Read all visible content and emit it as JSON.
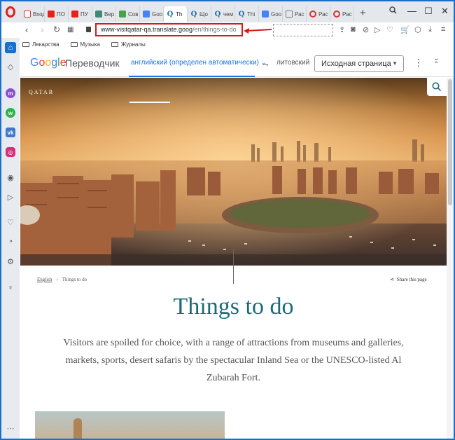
{
  "browser": {
    "tabs": [
      {
        "label": "Вход",
        "icon": "gmail-icon"
      },
      {
        "label": "ПО",
        "icon": "youtube-icon"
      },
      {
        "label": "ПУ",
        "icon": "youtube-icon"
      },
      {
        "label": "Вер",
        "icon": "tile-icon"
      },
      {
        "label": "Сов",
        "icon": "green-tile-icon"
      },
      {
        "label": "Goo",
        "icon": "google-icon"
      },
      {
        "label": "Th",
        "icon": "qatar-q-icon"
      },
      {
        "label": "Що",
        "icon": "qatar-q-icon"
      },
      {
        "label": "чем",
        "icon": "qatar-q-icon"
      },
      {
        "label": "Thi",
        "icon": "qatar-q-icon"
      },
      {
        "label": "Goo",
        "icon": "google-translate-icon"
      },
      {
        "label": "Рас",
        "icon": "cube-icon"
      },
      {
        "label": "Рас",
        "icon": "opera-icon"
      },
      {
        "label": "Рас",
        "icon": "opera-icon"
      }
    ],
    "url_host": "www-visitqatar-qa.translate.goog",
    "url_path": "/en/things-to-do",
    "bookmarks": [
      "Лекарства",
      "Музыка",
      "Журналы"
    ]
  },
  "translator": {
    "brand": "Google",
    "product": "Переводчик",
    "source_lang": "английский (определен автоматически)",
    "target_lang": "литовский",
    "view_mode": "Исходная страница"
  },
  "page": {
    "logo_text": "QATAR",
    "breadcrumb_home": "English",
    "breadcrumb_current": "Things to do",
    "share_label": "Share this page",
    "title": "Things to do",
    "intro": "Visitors are spoiled for choice, with a range of attractions from museums and galleries, markets, sports, desert safaris by the spectacular Inland Sea or the UNESCO-listed Al Zubarah Fort."
  },
  "colors": {
    "accent": "#1b6fc8",
    "highlight_red": "#d21c1c",
    "title_teal": "#1d6a78",
    "translate_blue": "#1a73e8"
  }
}
